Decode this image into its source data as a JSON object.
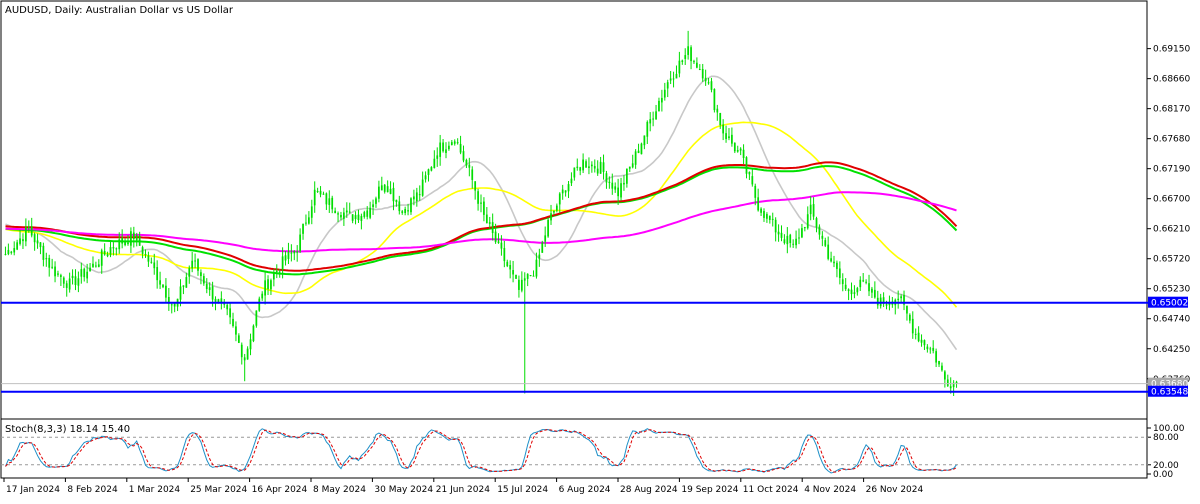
{
  "chart_data": [
    {
      "type": "candlestick",
      "title": "AUDUSD, Daily:  Australian Dollar vs US Dollar",
      "ylim": [
        0.6325,
        0.6965
      ],
      "y_ticks": [
        "0.69150",
        "0.68660",
        "0.68170",
        "0.67680",
        "0.67190",
        "0.66700",
        "0.66210",
        "0.65720",
        "0.65230",
        "0.64740",
        "0.64250",
        "0.63760"
      ],
      "x_labels": [
        "17 Jan 2024",
        "8 Feb 2024",
        "1 Mar 2024",
        "25 Mar 2024",
        "16 Apr 2024",
        "8 May 2024",
        "30 May 2024",
        "21 Jun 2024",
        "15 Jul 2024",
        "6 Aug 2024",
        "28 Aug 2024",
        "19 Sep 2024",
        "11 Oct 2024",
        "4 Nov 2024",
        "26 Nov 2024"
      ],
      "horizontal_lines": [
        {
          "price": 0.65002,
          "label": "0.65002",
          "color": "#0000ff"
        },
        {
          "price": 0.63548,
          "label": "0.63548",
          "color": "#0000ff"
        }
      ],
      "last_price_line": {
        "price": 0.6368,
        "label": "0.63680",
        "color": "#c0c0c0"
      },
      "series": [
        {
          "kind": "close-anchors",
          "points": [
            [
              0,
              0.658
            ],
            [
              8,
              0.662
            ],
            [
              16,
              0.6555
            ],
            [
              22,
              0.653
            ],
            [
              30,
              0.656
            ],
            [
              36,
              0.659
            ],
            [
              44,
              0.661
            ],
            [
              52,
              0.6545
            ],
            [
              58,
              0.649
            ],
            [
              64,
              0.657
            ],
            [
              70,
              0.652
            ],
            [
              76,
              0.648
            ],
            [
              82,
              0.641
            ],
            [
              88,
              0.652
            ],
            [
              94,
              0.656
            ],
            [
              100,
              0.659
            ],
            [
              106,
              0.668
            ],
            [
              112,
              0.666
            ],
            [
              118,
              0.664
            ],
            [
              124,
              0.665
            ],
            [
              130,
              0.67
            ],
            [
              136,
              0.665
            ],
            [
              142,
              0.668
            ],
            [
              148,
              0.675
            ],
            [
              154,
              0.677
            ],
            [
              160,
              0.67
            ],
            [
              164,
              0.664
            ],
            [
              170,
              0.658
            ],
            [
              176,
              0.652
            ],
            [
              182,
              0.656
            ],
            [
              186,
              0.663
            ],
            [
              192,
              0.669
            ],
            [
              198,
              0.673
            ],
            [
              204,
              0.672
            ],
            [
              210,
              0.668
            ],
            [
              216,
              0.674
            ],
            [
              222,
              0.681
            ],
            [
              228,
              0.687
            ],
            [
              234,
              0.691
            ],
            [
              240,
              0.687
            ],
            [
              246,
              0.678
            ],
            [
              252,
              0.674
            ],
            [
              258,
              0.666
            ],
            [
              264,
              0.662
            ],
            [
              270,
              0.659
            ],
            [
              276,
              0.665
            ],
            [
              282,
              0.658
            ],
            [
              288,
              0.652
            ],
            [
              294,
              0.653
            ],
            [
              300,
              0.65
            ],
            [
              306,
              0.651
            ],
            [
              312,
              0.645
            ],
            [
              318,
              0.642
            ],
            [
              322,
              0.6375
            ],
            [
              326,
              0.6368
            ]
          ]
        },
        {
          "name": "",
          "kind": "ma",
          "color": "#c8c8c8",
          "period": 20
        },
        {
          "name": "",
          "kind": "ma",
          "color": "#ffff00",
          "period": 50
        },
        {
          "name": "",
          "kind": "ma",
          "color": "#00e000",
          "period": 100
        },
        {
          "name": "",
          "kind": "ma",
          "color": "#e00000",
          "period": 100
        },
        {
          "name": "",
          "kind": "ma",
          "color": "#ff00ff",
          "period": 200
        }
      ]
    },
    {
      "type": "line",
      "title": "Stoch(8,3,3) 18.14 15.40",
      "ylim": [
        0,
        100
      ],
      "y_ticks": [
        "100.00",
        "80.00",
        "20.00",
        "0.00"
      ],
      "levels": [
        80,
        20
      ],
      "series": [
        {
          "name": "",
          "color": "#1e90c8"
        },
        {
          "name": "",
          "color": "#e00000"
        }
      ]
    }
  ]
}
